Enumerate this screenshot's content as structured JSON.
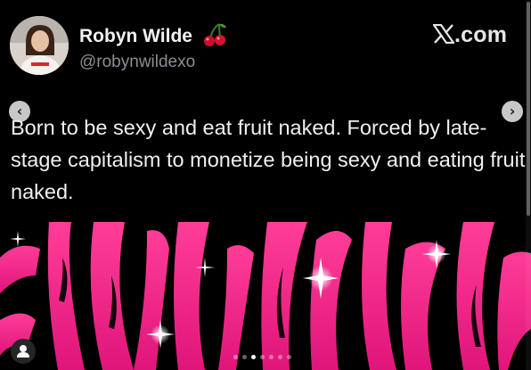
{
  "profile": {
    "display_name": "Robyn Wilde",
    "name_emoji": "cherry-emoji-icon",
    "handle": "@robynwildexo"
  },
  "site": {
    "logo_text": ".com",
    "logo_icon": "x-logo-icon"
  },
  "post": {
    "text": "Born to be sexy and eat fruit naked. Forced by late-stage capitalism to monetize being sexy and eating fruit naked."
  },
  "carousel": {
    "prev_icon": "chevron-left-icon",
    "next_icon": "chevron-right-icon",
    "slide_count": 7,
    "active_slide": 2
  },
  "user_button_icon": "user-icon",
  "colors": {
    "background": "#000000",
    "text": "#f0f0f0",
    "handle": "#8b8f94",
    "zebra_pink": "#ff2d8c"
  }
}
